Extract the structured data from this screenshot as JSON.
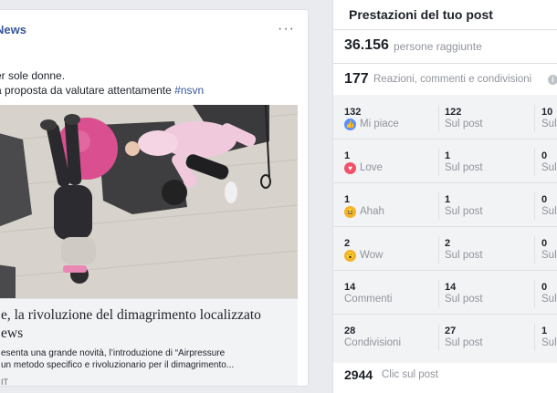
{
  "post": {
    "page_name": "News",
    "page_sub": "·",
    "more_label": "···",
    "text_line1": "er sole donne.",
    "text_line2": "a proposta da valutare attentamente",
    "hashtag": "#nsvn",
    "link_title_line1": "e, la rivoluzione del dimagrimento localizzato",
    "link_title_line2": "ews",
    "link_desc_line1": "esenta una grande novità, l’introduzione di “Airpressure",
    "link_desc_line2": "un metodo specifico e rivoluzionario per il dimagrimento...",
    "link_domain": "IT"
  },
  "stats": {
    "title": "Prestazioni del tuo post",
    "reach_value": "36.156",
    "reach_label": "persone raggiunte",
    "reactions_value": "177",
    "reactions_label": "Reazioni, commenti e condivisioni",
    "info_icon": "i",
    "rows": [
      {
        "icon": "like-icon",
        "icon_color": "#5890ff",
        "glyph": "👍",
        "c1_num": "132",
        "c1_label": "Mi piace",
        "c2_num": "122",
        "c2_label": "Sul post",
        "c3_num": "10",
        "c3_label": "Sul"
      },
      {
        "icon": "love-icon",
        "icon_color": "#f25268",
        "glyph": "♥",
        "c1_num": "1",
        "c1_label": "Love",
        "c2_num": "1",
        "c2_label": "Sul post",
        "c3_num": "0",
        "c3_label": "Sul"
      },
      {
        "icon": "haha-icon",
        "icon_color": "#f7b125",
        "glyph": "😆",
        "c1_num": "1",
        "c1_label": "Ahah",
        "c2_num": "1",
        "c2_label": "Sul post",
        "c3_num": "0",
        "c3_label": "Sul"
      },
      {
        "icon": "wow-icon",
        "icon_color": "#f7b125",
        "glyph": "😮",
        "c1_num": "2",
        "c1_label": "Wow",
        "c2_num": "2",
        "c2_label": "Sul post",
        "c3_num": "0",
        "c3_label": "Sul"
      },
      {
        "icon": "",
        "icon_color": "",
        "glyph": "",
        "c1_num": "14",
        "c1_label": "Commenti",
        "c2_num": "14",
        "c2_label": "Sul post",
        "c3_num": "0",
        "c3_label": "Sul"
      },
      {
        "icon": "",
        "icon_color": "",
        "glyph": "",
        "c1_num": "28",
        "c1_label": "Condivisioni",
        "c2_num": "27",
        "c2_label": "Sul post",
        "c3_num": "1",
        "c3_label": "Sul"
      }
    ],
    "clicks_value": "2944",
    "clicks_label": "Clic sul post"
  }
}
